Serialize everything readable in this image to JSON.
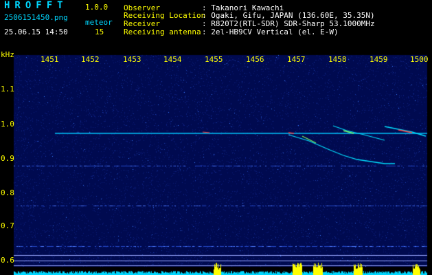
{
  "header": {
    "logo": "HROFFT",
    "version": "1.0.0",
    "filename": "2506151450.png",
    "datetime": "25.06.15 14:50",
    "meteor_label": "meteor",
    "meteor_count": "15"
  },
  "info": [
    {
      "label": "Observer",
      "value": ": Takanori Kawachi"
    },
    {
      "label": "Receiving Location",
      "value": ": Ogaki, Gifu, JAPAN (136.60E, 35.35N)"
    },
    {
      "label": "Receiver",
      "value": ": R820T2(RTL-SDR) SDR-Sharp 53.1000MHz"
    },
    {
      "label": "Receiving antenna",
      "value": ": 2el-HB9CV Vertical (el. E-W)"
    }
  ],
  "axis": {
    "unit": "kHz",
    "time_ticks": [
      "1451",
      "1452",
      "1453",
      "1454",
      "1455",
      "1456",
      "1457",
      "1458",
      "1459",
      "1500"
    ],
    "freq_ticks": [
      "1.1",
      "1.0",
      "0.9",
      "0.8",
      "0.7",
      "0.6"
    ]
  },
  "colors": {
    "background": "#000000",
    "plot_bg": "#000a50",
    "carrier": "#00c8ff",
    "meteor_hot": "#ff4040",
    "level_yellow": "#ffff00",
    "level_cyan": "#00d7ff"
  }
}
